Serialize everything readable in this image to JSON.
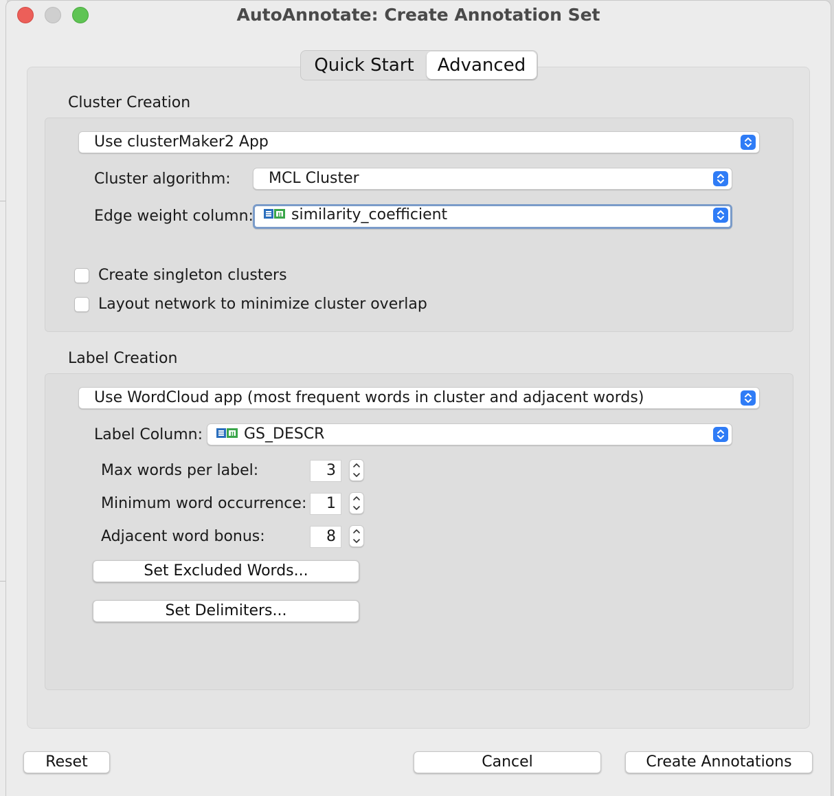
{
  "window": {
    "title": "AutoAnnotate: Create Annotation Set"
  },
  "tabs": [
    {
      "label": "Quick Start",
      "selected": false
    },
    {
      "label": "Advanced",
      "selected": true
    }
  ],
  "cluster_creation": {
    "heading": "Cluster Creation",
    "method": "Use clusterMaker2 App",
    "algorithm_label": "Cluster algorithm:",
    "algorithm_value": "MCL Cluster",
    "edge_weight_label": "Edge weight column:",
    "edge_weight_value": "similarity_coefficient",
    "singleton_label": "Create singleton clusters",
    "singleton_checked": false,
    "layout_label": "Layout network to minimize cluster overlap",
    "layout_checked": false
  },
  "label_creation": {
    "heading": "Label Creation",
    "method": "Use WordCloud app (most frequent words in cluster and adjacent words)",
    "label_column_label": "Label Column:",
    "label_column_value": "GS_DESCR",
    "max_words_label": "Max words per label:",
    "max_words_value": "3",
    "min_occurrence_label": "Minimum word occurrence:",
    "min_occurrence_value": "1",
    "adjacent_bonus_label": "Adjacent word bonus:",
    "adjacent_bonus_value": "8",
    "excluded_words_button": "Set Excluded Words...",
    "delimiters_button": "Set Delimiters..."
  },
  "footer": {
    "reset": "Reset",
    "cancel": "Cancel",
    "create": "Create Annotations"
  },
  "colors": {
    "accent": "#2f7cf6",
    "close": "#ec5f59",
    "zoom": "#5fc454",
    "column_icon_blue": "#2a6ebd",
    "column_icon_green": "#3aa64a"
  }
}
